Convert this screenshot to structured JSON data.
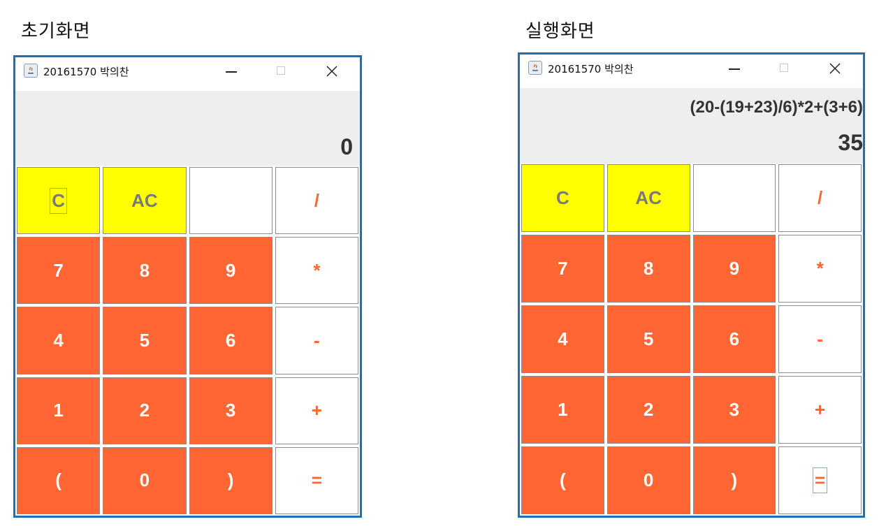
{
  "captions": {
    "initial": "초기화면",
    "running": "실행화면"
  },
  "windows": [
    {
      "title": "20161570 박의찬",
      "expression": "",
      "result": "0",
      "focused_key": 0
    },
    {
      "title": "20161570 박의찬",
      "expression": "(20-(19+23)/6)*2+(3+6)",
      "result": "35",
      "focused_key": 19
    }
  ],
  "keys": [
    {
      "label": "C",
      "style": "yellow",
      "name": "clear-button"
    },
    {
      "label": "AC",
      "style": "yellow",
      "name": "all-clear-button"
    },
    {
      "label": "",
      "style": "white",
      "name": "blank-button"
    },
    {
      "label": "/",
      "style": "white",
      "name": "divide-button"
    },
    {
      "label": "7",
      "style": "orange",
      "name": "digit-7-button"
    },
    {
      "label": "8",
      "style": "orange",
      "name": "digit-8-button"
    },
    {
      "label": "9",
      "style": "orange",
      "name": "digit-9-button"
    },
    {
      "label": "*",
      "style": "white",
      "name": "multiply-button"
    },
    {
      "label": "4",
      "style": "orange",
      "name": "digit-4-button"
    },
    {
      "label": "5",
      "style": "orange",
      "name": "digit-5-button"
    },
    {
      "label": "6",
      "style": "orange",
      "name": "digit-6-button"
    },
    {
      "label": "-",
      "style": "white",
      "name": "subtract-button"
    },
    {
      "label": "1",
      "style": "orange",
      "name": "digit-1-button"
    },
    {
      "label": "2",
      "style": "orange",
      "name": "digit-2-button"
    },
    {
      "label": "3",
      "style": "orange",
      "name": "digit-3-button"
    },
    {
      "label": "+",
      "style": "white",
      "name": "add-button"
    },
    {
      "label": "(",
      "style": "orange",
      "name": "open-paren-button"
    },
    {
      "label": "0",
      "style": "orange",
      "name": "digit-0-button"
    },
    {
      "label": ")",
      "style": "orange",
      "name": "close-paren-button"
    },
    {
      "label": "=",
      "style": "white",
      "name": "equals-button"
    }
  ],
  "colors": {
    "frame": "#1f6fb8",
    "yellow": "#ffff00",
    "orange": "#ff6633",
    "display_bg": "#eeeeee"
  }
}
